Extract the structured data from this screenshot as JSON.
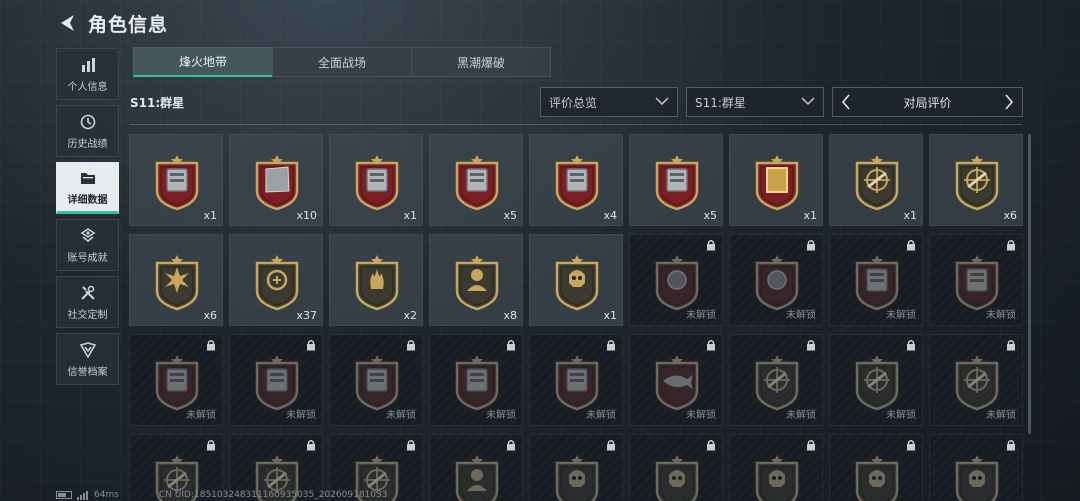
{
  "header": {
    "title": "角色信息"
  },
  "sidebar": {
    "items": [
      {
        "label": "个人信息",
        "icon": "bar-chart-icon"
      },
      {
        "label": "历史战绩",
        "icon": "history-clock-icon"
      },
      {
        "label": "详细数据",
        "icon": "folder-icon",
        "active": true
      },
      {
        "label": "账号成就",
        "icon": "achievement-icon"
      },
      {
        "label": "社交定制",
        "icon": "tools-icon"
      },
      {
        "label": "信誉档案",
        "icon": "reputation-shield-icon"
      }
    ]
  },
  "tabs": [
    {
      "label": "烽火地带",
      "active": true
    },
    {
      "label": "全面战场"
    },
    {
      "label": "黑潮爆破"
    }
  ],
  "filters": {
    "season_label": "S11:群星",
    "dropdown_1": "评价总览",
    "dropdown_2": "S11:群星",
    "pager_label": "对局评价"
  },
  "colors": {
    "accent": "#37c3a0",
    "badge_red": "#7a1f24",
    "badge_gold": "#c8a65a"
  },
  "grid": {
    "locked_text": "未解锁",
    "rows": [
      [
        {
          "icon": "tablet-device-badge",
          "count": "x1"
        },
        {
          "icon": "metal-plate-badge",
          "count": "x10"
        },
        {
          "icon": "server-rack-badge",
          "count": "x1"
        },
        {
          "icon": "document-tag-badge",
          "count": "x5"
        },
        {
          "icon": "machine-unit-badge",
          "count": "x4"
        },
        {
          "icon": "vehicle-parts-badge",
          "count": "x5"
        },
        {
          "icon": "golden-painting-badge",
          "count": "x1"
        },
        {
          "icon": "crosshair-rifle-badge",
          "count": "x1"
        },
        {
          "icon": "crosshair-knife-badge",
          "count": "x6"
        }
      ],
      [
        {
          "icon": "explosion-star-badge",
          "count": "x6"
        },
        {
          "icon": "laurel-emblem-badge",
          "count": "x37"
        },
        {
          "icon": "triple-flame-badge",
          "count": "x2"
        },
        {
          "icon": "soldier-bust-badge",
          "count": "x8"
        },
        {
          "icon": "helmet-skull-badge",
          "count": "x1"
        },
        {
          "icon": "ore-rock-badge",
          "locked": true
        },
        {
          "icon": "sphere-badge",
          "locked": true
        },
        {
          "icon": "tank-badge",
          "locked": true
        },
        {
          "icon": "arcade-machine-badge",
          "locked": true
        }
      ],
      [
        {
          "icon": "lantern-badge",
          "locked": true
        },
        {
          "icon": "chest-badge",
          "locked": true
        },
        {
          "icon": "chessboard-badge",
          "locked": true
        },
        {
          "icon": "cabinet-badge",
          "locked": true
        },
        {
          "icon": "robot-badge",
          "locked": true
        },
        {
          "icon": "fish-badge",
          "locked": true
        },
        {
          "icon": "crosshair-rifle-badge",
          "locked": true
        },
        {
          "icon": "crosshair-rifle-badge",
          "locked": true
        },
        {
          "icon": "crosshair-rifle-badge",
          "locked": true
        }
      ],
      [
        {
          "icon": "crosshair-badge",
          "locked": true
        },
        {
          "icon": "crosshair-badge",
          "locked": true
        },
        {
          "icon": "crosshair-badge",
          "locked": true
        },
        {
          "icon": "soldier-badge",
          "locked": true
        },
        {
          "icon": "skull-badge",
          "locked": true
        },
        {
          "icon": "skull-badge",
          "locked": true
        },
        {
          "icon": "skull-badge",
          "locked": true
        },
        {
          "icon": "skull-badge",
          "locked": true
        },
        {
          "icon": "skull-badge",
          "locked": true
        }
      ]
    ]
  },
  "footer": {
    "ping": "64ms",
    "uid": "CN UID:185103248311160935035_202609181033"
  }
}
